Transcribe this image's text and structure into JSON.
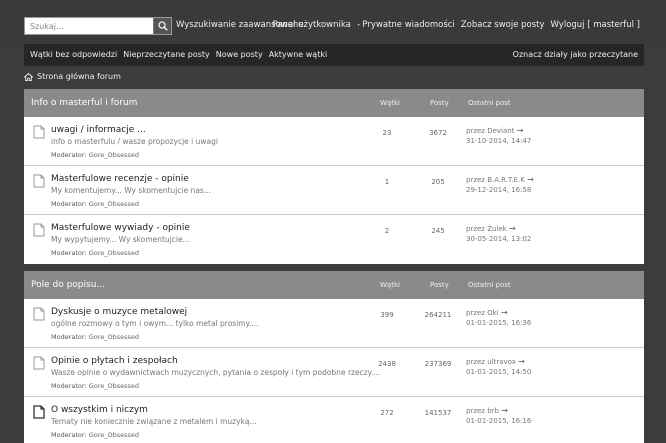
{
  "header": {
    "search_placeholder": "Szukaj…",
    "advanced_search": "Wyszukiwanie zaawansowane",
    "user_links": {
      "panel": "Panel użytkownika",
      "pm_icon": "•",
      "private_messages": "Prywatne wiadomości",
      "your_posts": "Zobacz swoje posty",
      "logout": "Wyloguj [ masterful ]"
    }
  },
  "nav": {
    "items": [
      "Wątki bez odpowiedzi",
      "Nieprzeczytane posty",
      "Nowe posty",
      "Aktywne wątki"
    ],
    "mark_read": "Oznacz działy jako przeczytane"
  },
  "breadcrumb": {
    "home": "Strona główna forum"
  },
  "sections": [
    {
      "title": "Info o masterful i forum",
      "col_topics": "Wątki",
      "col_posts": "Posty",
      "col_last": "Ostatni post",
      "forums": [
        {
          "title": "uwagi / informacje ...",
          "desc": "info o masterfulu / wasze propozycje i uwagi",
          "mod_label": "Moderator:",
          "mod_name": "Gore_Obsessed",
          "topics": "23",
          "posts": "3672",
          "last_by": "przez Deviant",
          "last_date": "31-10-2014, 14:47"
        },
        {
          "title": "Masterfulowe recenzje - opinie",
          "desc": "My komentujemy... Wy skomentujcie nas...",
          "mod_label": "Moderator:",
          "mod_name": "Gore_Obsessed",
          "topics": "1",
          "posts": "205",
          "last_by": "przez B.A.R.T.E.K",
          "last_date": "29-12-2014, 16:58"
        },
        {
          "title": "Masterfulowe wywiady - opinie",
          "desc": "My wypytujemy... Wy skomentujcie...",
          "mod_label": "Moderator:",
          "mod_name": "Gore_Obsessed",
          "topics": "2",
          "posts": "245",
          "last_by": "przez Żulek",
          "last_date": "30-05-2014, 13:02"
        }
      ]
    },
    {
      "title": "Pole do popisu...",
      "col_topics": "Wątki",
      "col_posts": "Posty",
      "col_last": "Ostatni post",
      "forums": [
        {
          "title": "Dyskusje o muzyce metalowej",
          "desc": "ogólne rozmowy o tym i owym... tylko    metal prosimy....",
          "mod_label": "Moderator:",
          "mod_name": "Gore_Obsessed",
          "topics": "399",
          "posts": "264211",
          "last_by": "przez Oki",
          "last_date": "01-01-2015, 16:36"
        },
        {
          "title": "Opinie o płytach i zespołach",
          "desc": "Wasze opinie o wydawnictwach muzycznych, pytania o zespoły i tym podobne rzeczy....",
          "mod_label": "Moderator:",
          "mod_name": "Gore_Obsessed",
          "topics": "2438",
          "posts": "237369",
          "last_by": "przez ultravox",
          "last_date": "01-01-2015, 14:50"
        },
        {
          "title": "O wszystkim i niczym",
          "desc": "Tematy nie koniecznie związane z metalem i muzyką...",
          "mod_label": "Moderator:",
          "mod_name": "Gore_Obsessed",
          "topics": "272",
          "posts": "141537",
          "last_by": "przez brb",
          "last_date": "01-01-2015, 16:16"
        }
      ]
    }
  ]
}
